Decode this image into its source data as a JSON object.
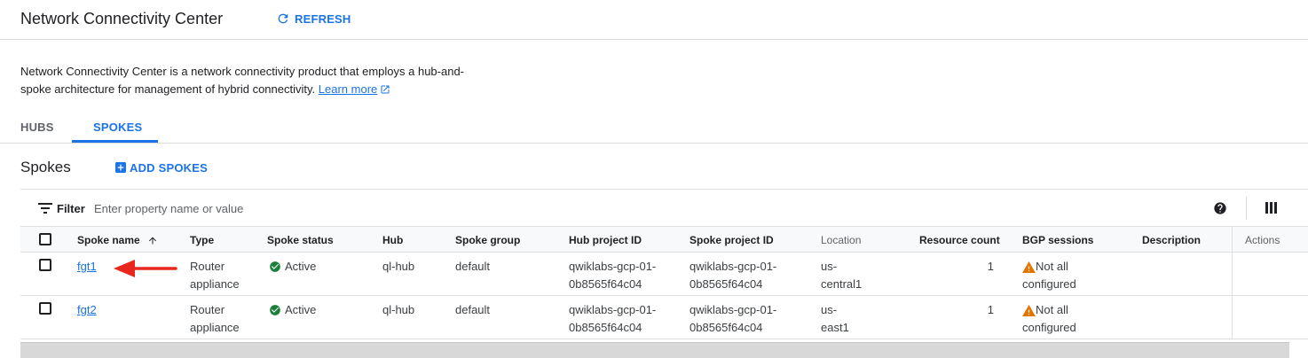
{
  "header": {
    "title": "Network Connectivity Center",
    "refresh_label": "REFRESH"
  },
  "description": {
    "text": "Network Connectivity Center is a network connectivity product that employs a hub-and-spoke architecture for management of hybrid connectivity.",
    "learn_more": "Learn more"
  },
  "tabs": [
    {
      "label": "HUBS",
      "active": false
    },
    {
      "label": "SPOKES",
      "active": true
    }
  ],
  "section": {
    "title": "Spokes",
    "add_label": "ADD SPOKES"
  },
  "filter": {
    "label": "Filter",
    "placeholder": "Enter property name or value"
  },
  "table": {
    "columns": [
      "Spoke name",
      "Type",
      "Spoke status",
      "Hub",
      "Spoke group",
      "Hub project ID",
      "Spoke project ID",
      "Location",
      "Resource count",
      "BGP sessions",
      "Description",
      "Actions"
    ],
    "sort_column": "Spoke name",
    "rows": [
      {
        "name": "fgt1",
        "type_line1": "Router",
        "type_line2": "appliance",
        "status": "Active",
        "hub": "ql-hub",
        "group": "default",
        "hub_project_line1": "qwiklabs-gcp-01-",
        "hub_project_line2": "0b8565f64c04",
        "spoke_project_line1": "qwiklabs-gcp-01-",
        "spoke_project_line2": "0b8565f64c04",
        "location_line1": "us-",
        "location_line2": "central1",
        "resource_count": "1",
        "bgp_line1": "Not all",
        "bgp_line2": "configured",
        "description": ""
      },
      {
        "name": "fgt2",
        "type_line1": "Router",
        "type_line2": "appliance",
        "status": "Active",
        "hub": "ql-hub",
        "group": "default",
        "hub_project_line1": "qwiklabs-gcp-01-",
        "hub_project_line2": "0b8565f64c04",
        "spoke_project_line1": "qwiklabs-gcp-01-",
        "spoke_project_line2": "0b8565f64c04",
        "location_line1": "us-",
        "location_line2": "east1",
        "resource_count": "1",
        "bgp_line1": "Not all",
        "bgp_line2": "configured",
        "description": ""
      }
    ]
  },
  "icons": {
    "refresh": "refresh-icon",
    "external": "external-link-icon",
    "add": "add-box-icon",
    "filter": "filter-icon",
    "help": "help-icon",
    "columns": "column-display-icon",
    "sort": "arrow-up-icon",
    "status_ok": "check-circle-icon",
    "warning": "warning-icon",
    "annotation": "red-arrow-icon"
  },
  "colors": {
    "accent": "#1a73e8",
    "success": "#188038",
    "warning": "#e37400",
    "annotation": "#e8271f"
  }
}
